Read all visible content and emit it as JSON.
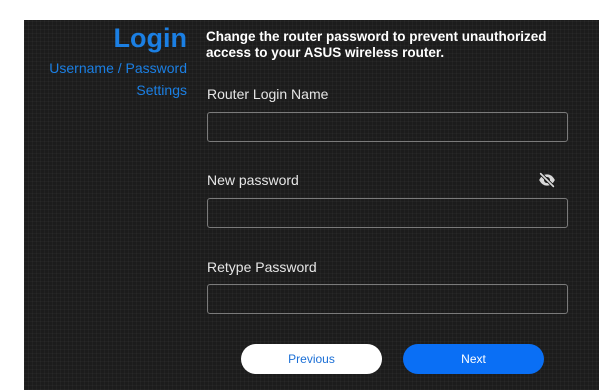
{
  "sidebar": {
    "title": "Login",
    "subtitle_line1": "Username / Password",
    "subtitle_line2": "Settings"
  },
  "description": "Change the router password to prevent unauthorized access to your ASUS wireless router.",
  "form": {
    "login_name": {
      "label": "Router Login Name",
      "value": ""
    },
    "new_password": {
      "label": "New password",
      "value": "",
      "toggle_icon": "eye-slash-icon"
    },
    "retype_password": {
      "label": "Retype Password",
      "value": ""
    }
  },
  "buttons": {
    "previous": "Previous",
    "next": "Next"
  },
  "colors": {
    "accent": "#1b7fe3",
    "next_button": "#0a6ff5",
    "background": "#1c1c1c"
  }
}
